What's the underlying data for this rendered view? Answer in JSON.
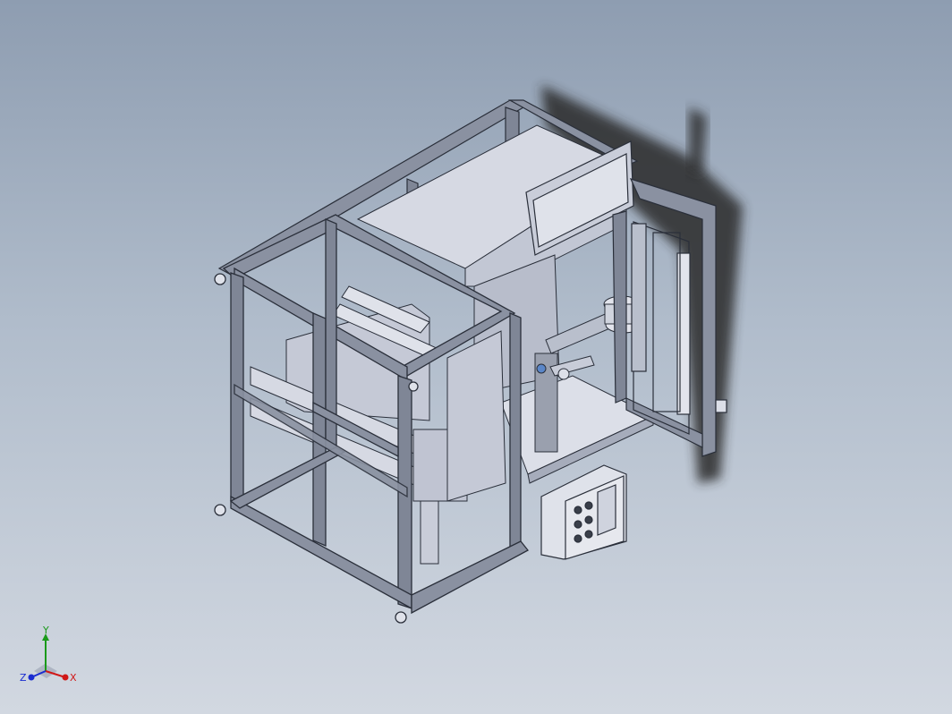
{
  "viewport": {
    "background_top": "#8e9db1",
    "background_bottom": "#d2d8e1"
  },
  "model": {
    "frame_color": "#7f8696",
    "frame_edge": "#2a2f3a",
    "panel_color": "#c9cdd9",
    "light_panel_color": "#dfe2ea",
    "shadow_color": "#2b2b2b"
  },
  "triad": {
    "x_label": "X",
    "y_label": "Y",
    "z_label": "Z",
    "x_color": "#d01818",
    "y_color": "#1a9a1a",
    "z_color": "#1a2cd0"
  }
}
